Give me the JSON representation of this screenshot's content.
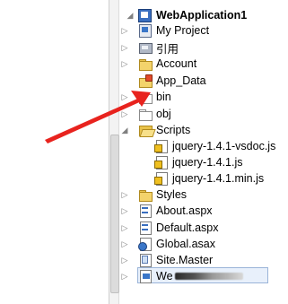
{
  "tree": {
    "root": {
      "label": "WebApplication1",
      "expander": "◢"
    },
    "items": [
      {
        "label": "My Project",
        "expander": "▷"
      },
      {
        "label": "引用",
        "expander": "▷"
      },
      {
        "label": "Account",
        "expander": "▷"
      },
      {
        "label": "App_Data",
        "expander": ""
      },
      {
        "label": "bin",
        "expander": "▷"
      },
      {
        "label": "obj",
        "expander": "▷"
      },
      {
        "label": "Scripts",
        "expander": "◢"
      },
      {
        "label": "jquery-1.4.1-vsdoc.js",
        "expander": ""
      },
      {
        "label": "jquery-1.4.1.js",
        "expander": ""
      },
      {
        "label": "jquery-1.4.1.min.js",
        "expander": ""
      },
      {
        "label": "Styles",
        "expander": "▷"
      },
      {
        "label": "About.aspx",
        "expander": "▷"
      },
      {
        "label": "Default.aspx",
        "expander": "▷"
      },
      {
        "label": "Global.asax",
        "expander": "▷"
      },
      {
        "label": "Site.Master",
        "expander": "▷"
      },
      {
        "label": "We",
        "expander": "▷"
      }
    ]
  },
  "colors": {
    "arrow": "#e8231e",
    "selection_border": "#9ab4d8",
    "selection_fill": "#e8f0fb"
  }
}
